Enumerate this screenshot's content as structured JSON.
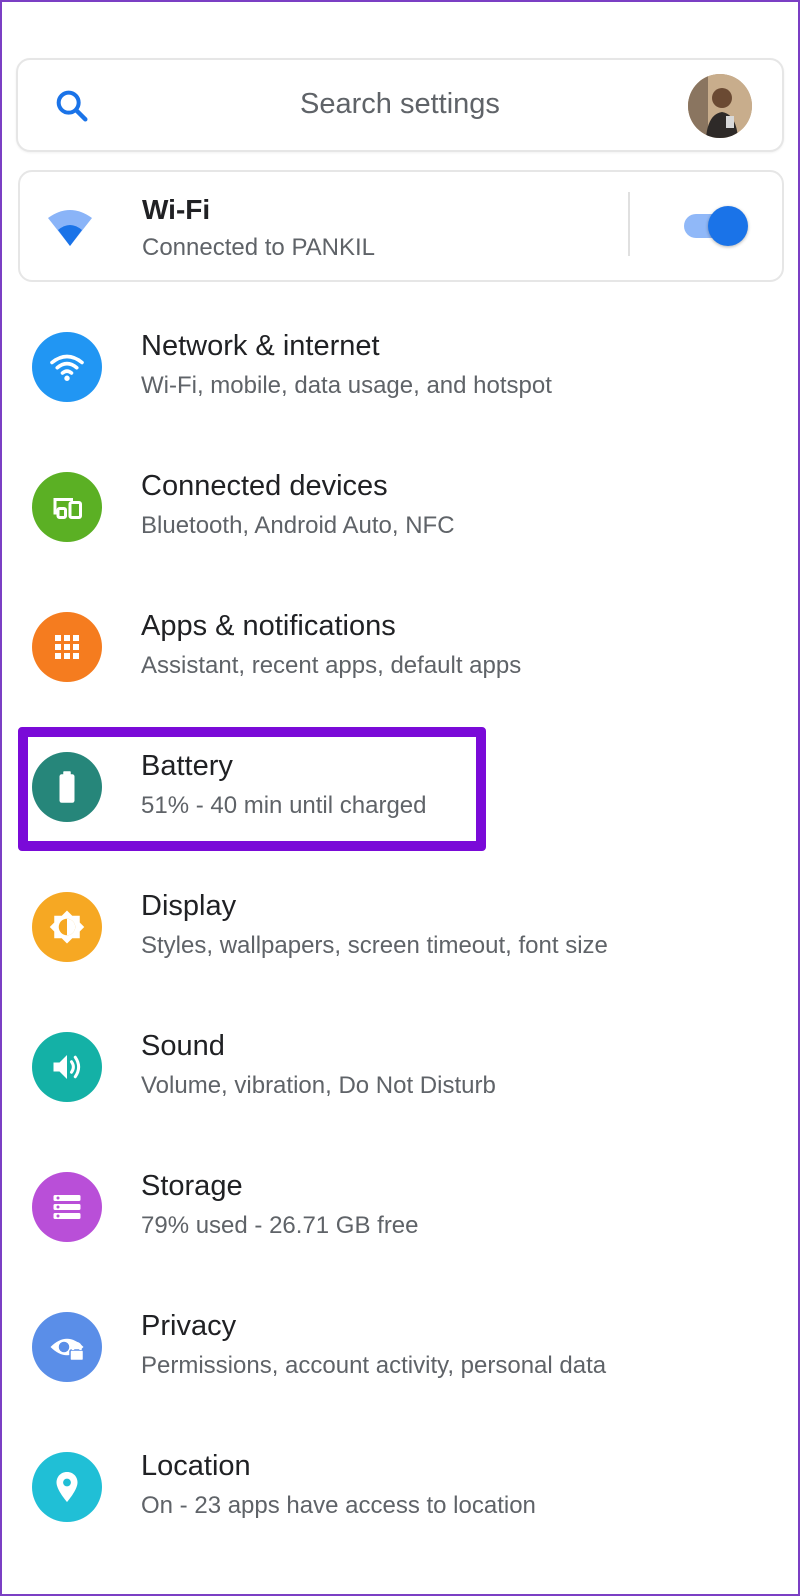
{
  "search": {
    "placeholder": "Search settings"
  },
  "wifi_card": {
    "title": "Wi-Fi",
    "subtitle": "Connected to PANKIL",
    "toggle_on": true
  },
  "items": [
    {
      "title": "Network & internet",
      "subtitle": "Wi-Fi, mobile, data usage, and hotspot",
      "icon": "wifi-icon",
      "color": "#2196f3"
    },
    {
      "title": "Connected devices",
      "subtitle": "Bluetooth, Android Auto, NFC",
      "icon": "devices-icon",
      "color": "#5bb024"
    },
    {
      "title": "Apps & notifications",
      "subtitle": "Assistant, recent apps, default apps",
      "icon": "apps-grid-icon",
      "color": "#f57c1f"
    },
    {
      "title": "Battery",
      "subtitle": "51% - 40 min until charged",
      "icon": "battery-icon",
      "color": "#26867a"
    },
    {
      "title": "Display",
      "subtitle": "Styles, wallpapers, screen timeout, font size",
      "icon": "brightness-icon",
      "color": "#f6a823"
    },
    {
      "title": "Sound",
      "subtitle": "Volume, vibration, Do Not Disturb",
      "icon": "volume-icon",
      "color": "#14b1a6"
    },
    {
      "title": "Storage",
      "subtitle": "79% used - 26.71 GB free",
      "icon": "storage-icon",
      "color": "#b94fd8"
    },
    {
      "title": "Privacy",
      "subtitle": "Permissions, account activity, personal data",
      "icon": "privacy-eye-icon",
      "color": "#5a8ee8"
    },
    {
      "title": "Location",
      "subtitle": "On - 23 apps have access to location",
      "icon": "location-pin-icon",
      "color": "#20bfd6"
    }
  ],
  "colors": {
    "accent": "#1a73e8",
    "highlight": "#7a0ad8"
  }
}
